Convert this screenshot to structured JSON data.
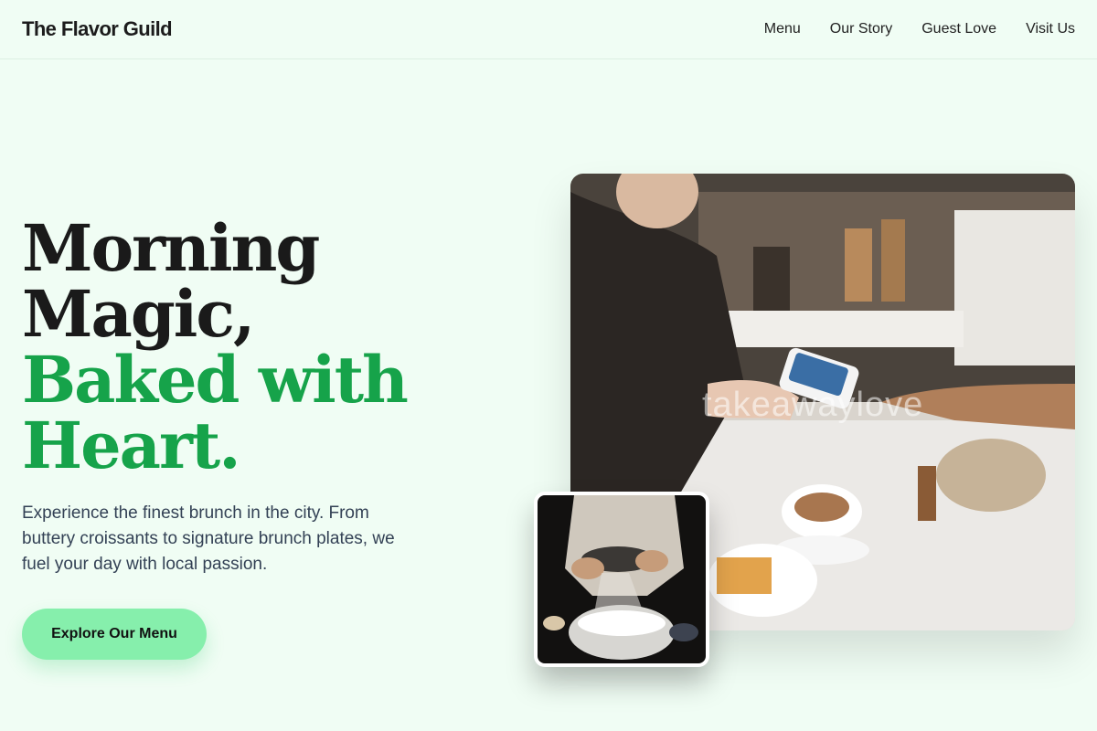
{
  "header": {
    "brand": "The Flavor Guild",
    "nav": [
      "Menu",
      "Our Story",
      "Guest Love",
      "Visit Us"
    ]
  },
  "hero": {
    "headline_line1": "Morning Magic,",
    "headline_line2": "Baked with",
    "headline_line3": "Heart.",
    "lead": "Experience the finest brunch in the city. From buttery croissants to signature brunch plates, we fuel your day with local passion.",
    "cta_label": "Explore Our Menu"
  },
  "images": {
    "main_alt": "Barista taking a card payment at a cafe counter with latte",
    "small_alt": "Hands sifting flour into a bowl",
    "watermark": "takeawaylove"
  },
  "colors": {
    "background": "#f0fdf4",
    "accent_green": "#16a34a",
    "cta_bg": "#86efac",
    "text_dark": "#1a1a1a"
  }
}
